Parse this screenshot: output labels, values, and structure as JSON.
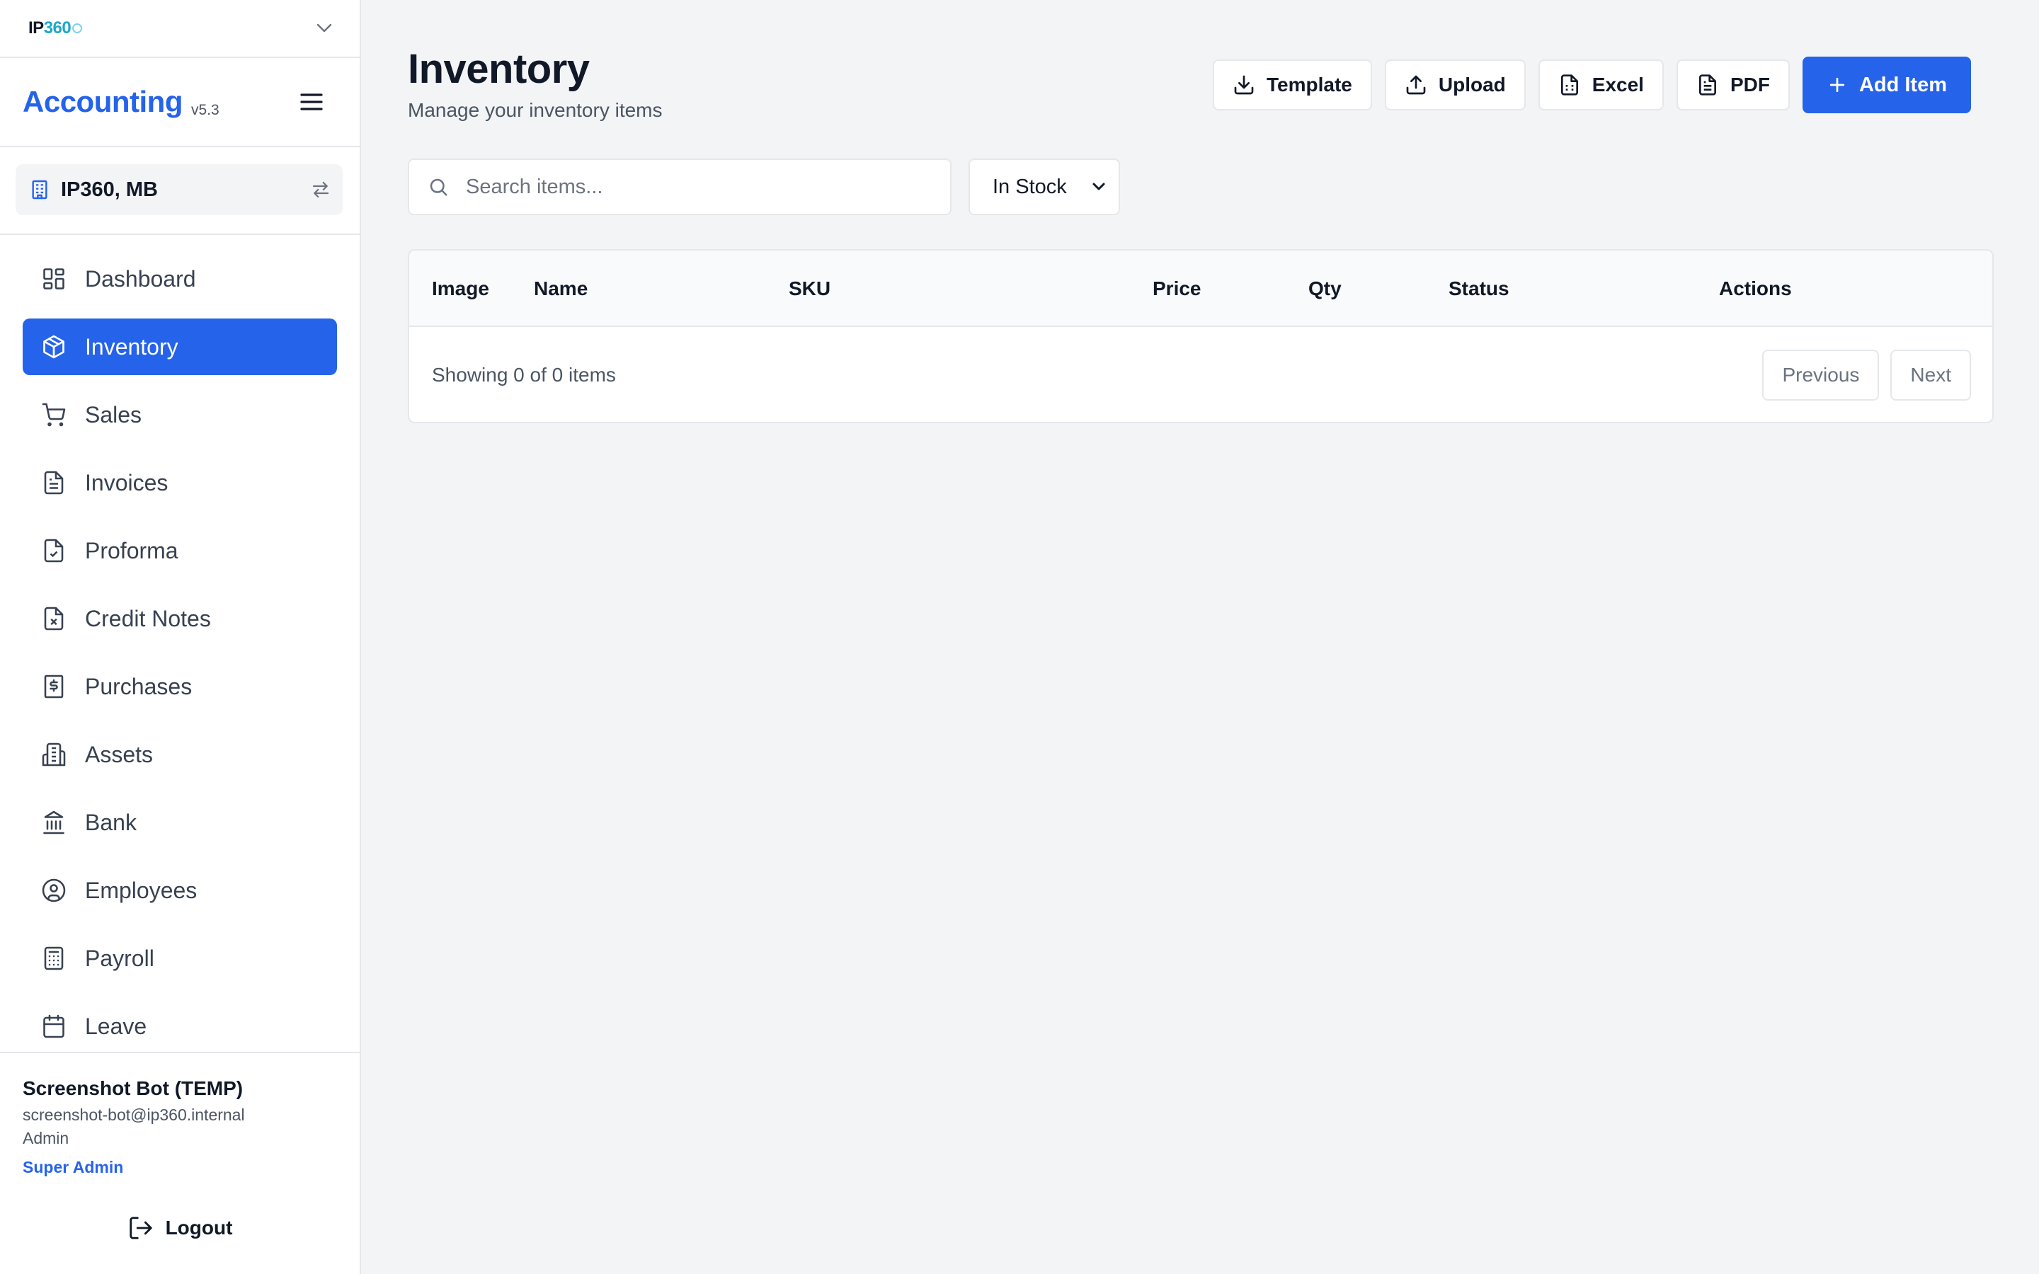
{
  "sidebar": {
    "logo": {
      "ip": "IP",
      "num": "360"
    },
    "brand": {
      "name": "Accounting",
      "version": "v5.3"
    },
    "company": {
      "name": "IP360, MB"
    },
    "items": [
      {
        "label": "Dashboard",
        "icon": "dashboard-icon",
        "active": false
      },
      {
        "label": "Inventory",
        "icon": "box-icon",
        "active": true
      },
      {
        "label": "Sales",
        "icon": "cart-icon",
        "active": false
      },
      {
        "label": "Invoices",
        "icon": "file-text-icon",
        "active": false
      },
      {
        "label": "Proforma",
        "icon": "file-check-icon",
        "active": false
      },
      {
        "label": "Credit Notes",
        "icon": "file-x-icon",
        "active": false
      },
      {
        "label": "Purchases",
        "icon": "receipt-icon",
        "active": false
      },
      {
        "label": "Assets",
        "icon": "building-icon",
        "active": false
      },
      {
        "label": "Bank",
        "icon": "bank-icon",
        "active": false
      },
      {
        "label": "Employees",
        "icon": "user-circle-icon",
        "active": false
      },
      {
        "label": "Payroll",
        "icon": "calculator-icon",
        "active": false
      },
      {
        "label": "Leave",
        "icon": "calendar-icon",
        "active": false
      }
    ],
    "user": {
      "name": "Screenshot Bot (TEMP)",
      "email": "screenshot-bot@ip360.internal",
      "role": "Admin",
      "badge": "Super Admin"
    },
    "logout_label": "Logout"
  },
  "main": {
    "title": "Inventory",
    "subtitle": "Manage your inventory items",
    "toolbar": {
      "template_label": "Template",
      "upload_label": "Upload",
      "excel_label": "Excel",
      "pdf_label": "PDF",
      "add_label": "Add Item"
    },
    "search": {
      "placeholder": "Search items...",
      "value": ""
    },
    "filter": {
      "selected": "In Stock"
    },
    "table": {
      "columns": [
        "Image",
        "Name",
        "SKU",
        "Price",
        "Qty",
        "Status",
        "Actions"
      ],
      "rows": [],
      "footer": "Showing 0 of 0 items",
      "prev_label": "Previous",
      "next_label": "Next"
    }
  },
  "colors": {
    "accent": "#2563eb",
    "logo_accent": "#1ea7c9",
    "background": "#f3f4f6",
    "border": "#e5e7eb"
  }
}
